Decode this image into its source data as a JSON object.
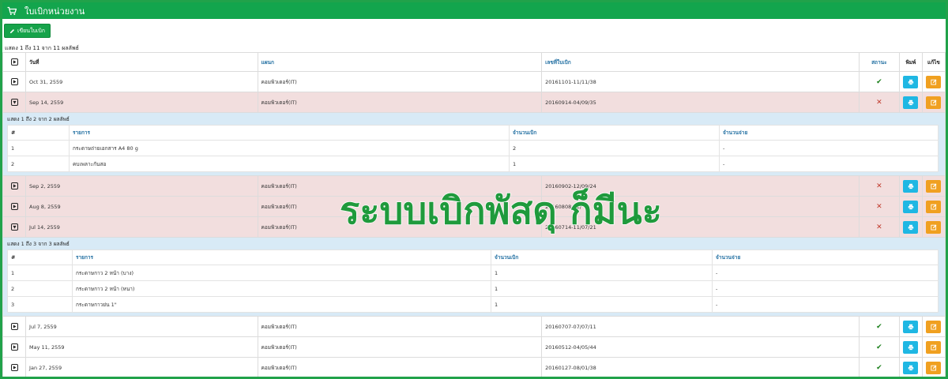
{
  "window": {
    "title": "ใบเบิกหน่วยงาน",
    "icon": "shopping-cart-icon",
    "brand_color": "#13a54d"
  },
  "toolbar": {
    "new_label": "เขียนใบเบิก",
    "new_icon": "pencil-icon"
  },
  "main": {
    "info": "แสดง 1 ถึง 11 จาก 11 ผลลัพธ์",
    "columns": {
      "date": "วันที่",
      "department": "แผนก",
      "number": "เลขที่ใบเบิก",
      "status": "สถานะ",
      "print": "พิมพ์",
      "edit": "แก้ไข"
    },
    "rows": [
      {
        "date": "Oct 31, 2559",
        "department": "คอมพิวเตอร์(IT)",
        "number": "20161101-11/11/38",
        "status": "approved",
        "expanded": false
      },
      {
        "date": "Sep 14, 2559",
        "department": "คอมพิวเตอร์(IT)",
        "number": "20160914-04/09/35",
        "status": "rejected",
        "expanded": true
      },
      {
        "date": "Sep 2, 2559",
        "department": "คอมพิวเตอร์(IT)",
        "number": "20160902-12/09/24",
        "status": "rejected",
        "expanded": false
      },
      {
        "date": "Aug 8, 2559",
        "department": "คอมพิวเตอร์(IT)",
        "number": "20160808-02/",
        "status": "rejected",
        "expanded": false
      },
      {
        "date": "Jul 14, 2559",
        "department": "คอมพิวเตอร์(IT)",
        "number": "20160714-11/07/21",
        "status": "rejected",
        "expanded": true
      },
      {
        "date": "Jul 7, 2559",
        "department": "คอมพิวเตอร์(IT)",
        "number": "20160707-07/07/11",
        "status": "approved",
        "expanded": false
      },
      {
        "date": "May 11, 2559",
        "department": "คอมพิวเตอร์(IT)",
        "number": "20160512-04/05/44",
        "status": "approved",
        "expanded": false
      },
      {
        "date": "Jan 27, 2559",
        "department": "คอมพิวเตอร์(IT)",
        "number": "20160127-08/01/38",
        "status": "approved",
        "expanded": false
      }
    ]
  },
  "details": [
    {
      "info": "แสดง 1 ถึง 2 จาก 2 ผลลัพธ์",
      "columns": {
        "no": "#",
        "item": "รายการ",
        "requested": "จำนวนเบิก",
        "issued": "จำนวนจ่าย"
      },
      "items": [
        {
          "no": "1",
          "item": "กระดาษถ่ายเอกสาร A4 80 g",
          "requested": "2",
          "issued": "-"
        },
        {
          "no": "2",
          "item": "คบเพลาะกันสอ",
          "requested": "1",
          "issued": "-"
        }
      ]
    },
    {
      "info": "แสดง 1 ถึง 3 จาก 3 ผลลัพธ์",
      "columns": {
        "no": "#",
        "item": "รายการ",
        "requested": "จำนวนเบิก",
        "issued": "จำนวนจ่าย"
      },
      "items": [
        {
          "no": "1",
          "item": "กระดาษกาว 2 หน้า (บาง)",
          "requested": "1",
          "issued": "-"
        },
        {
          "no": "2",
          "item": "กระดาษกาว 2 หน้า (หนา)",
          "requested": "1",
          "issued": "-"
        },
        {
          "no": "3",
          "item": "กระดาษกาวย่น 1\"",
          "requested": "1",
          "issued": "-"
        }
      ]
    }
  ],
  "overlay": {
    "text": "ระบบเบิกพัสดุ ก็มีนะ",
    "color": "#1f9a3c"
  },
  "glyphs": {
    "approved": "✔",
    "rejected": "✕"
  },
  "colors": {
    "approved": "#1a7f1a",
    "rejected": "#c0392b",
    "print_button": "#1fb7e3",
    "edit_button": "#f0a020",
    "rejected_row": "#f2dede",
    "detail_bg": "#d8eaf6"
  }
}
